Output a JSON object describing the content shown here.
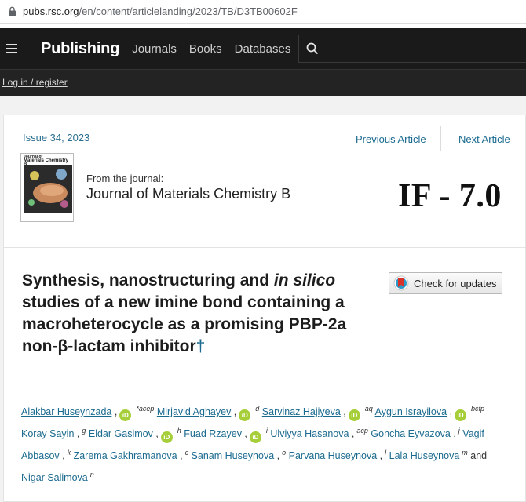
{
  "browser": {
    "url_host": "pubs.rsc.org",
    "url_path": "/en/content/articlelanding/2023/TB/D3TB00602F"
  },
  "nav": {
    "brand": "Publishing",
    "links": [
      "Journals",
      "Books",
      "Databases"
    ],
    "login": "Log in / register"
  },
  "article_header": {
    "issue": "Issue 34, 2023",
    "previous": "Previous Article",
    "next": "Next Article",
    "cover_title_line1": "Journal of",
    "cover_title_line2": "Materials Chemistry B",
    "from_label": "From the journal:",
    "journal_name": "Journal of Materials Chemistry B",
    "impact_factor": "IF - 7.0"
  },
  "article": {
    "title_part1": "Synthesis, nanostructuring and ",
    "title_italic": "in silico",
    "title_part2": " studies of a new imine bond containing a macroheterocycle as a promising PBP-2a non-β-lactam inhibitor",
    "dagger": "†",
    "check_updates": "Check for updates"
  },
  "authors": [
    {
      "name": "Alakbar Huseynzada",
      "orcid": true,
      "aff": "*acep"
    },
    {
      "name": "Mirjavid Aghayev",
      "orcid": true,
      "aff": "d"
    },
    {
      "name": "Sarvinaz Hajiyeva",
      "orcid": true,
      "aff": "aq"
    },
    {
      "name": "Aygun Israyilova",
      "orcid": true,
      "aff": "bcfp"
    },
    {
      "name": "Koray Sayin",
      "orcid": false,
      "aff": "g"
    },
    {
      "name": "Eldar Gasimov",
      "orcid": true,
      "aff": "h"
    },
    {
      "name": "Fuad Rzayev",
      "orcid": true,
      "aff": "i"
    },
    {
      "name": "Ulviyya Hasanova",
      "orcid": false,
      "aff": "acp"
    },
    {
      "name": "Goncha Eyvazova",
      "orcid": false,
      "aff": "j"
    },
    {
      "name": "Vagif Abbasov",
      "orcid": false,
      "aff": "k"
    },
    {
      "name": "Zarema Gakhramanova",
      "orcid": false,
      "aff": "c"
    },
    {
      "name": "Sanam Huseynova",
      "orcid": false,
      "aff": "o"
    },
    {
      "name": "Parvana Huseynova",
      "orcid": false,
      "aff": "l"
    },
    {
      "name": "Lala Huseynova",
      "orcid": false,
      "aff": "m"
    },
    {
      "name": "Nigar Salimova",
      "orcid": false,
      "aff": "n"
    }
  ],
  "authors_conjunction": "and",
  "colors": {
    "link": "#1b6a8f",
    "nav_bg": "#1a1a1a",
    "orcid": "#a6ce39"
  }
}
